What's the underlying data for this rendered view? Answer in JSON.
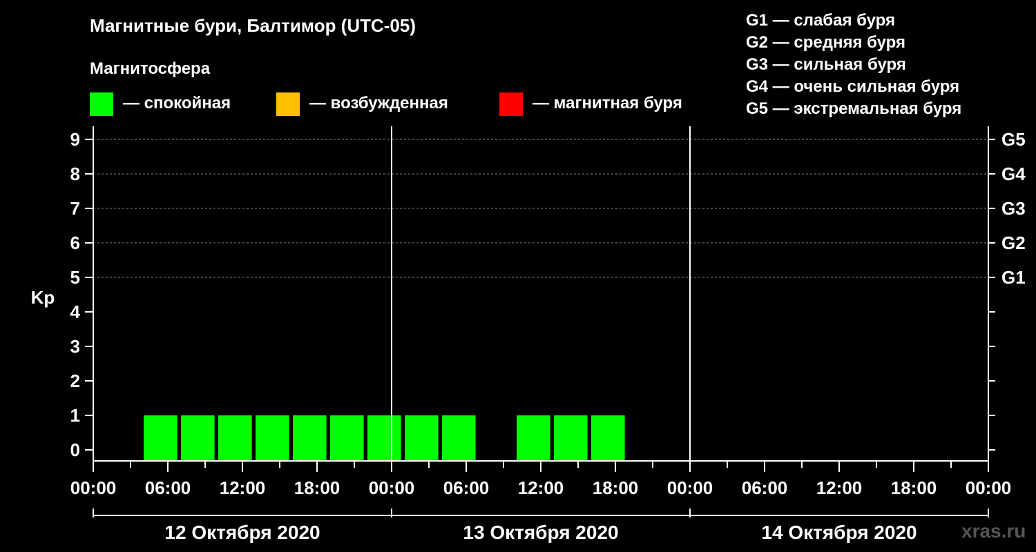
{
  "title": "Магнитные бури, Балтимор (UTC-05)",
  "subtitle": "Магнитосфера",
  "legend": [
    {
      "label": "— спокойная",
      "color": "#00ff00"
    },
    {
      "label": "— возбужденная",
      "color": "#ffbf00"
    },
    {
      "label": "— магнитная буря",
      "color": "#ff0000"
    }
  ],
  "gscale": [
    "G1 — слабая буря",
    "G2 — средняя буря",
    "G3 — сильная буря",
    "G4 — очень сильная буря",
    "G5 — экстремальная буря"
  ],
  "watermark": "xras.ru",
  "chart_data": {
    "type": "bar",
    "ylabel": "Kp",
    "ylim": [
      0,
      9
    ],
    "yticks": [
      0,
      1,
      2,
      3,
      4,
      5,
      6,
      7,
      8,
      9
    ],
    "right_labels": [
      {
        "y": 5,
        "label": "G1"
      },
      {
        "y": 6,
        "label": "G2"
      },
      {
        "y": 7,
        "label": "G3"
      },
      {
        "y": 8,
        "label": "G4"
      },
      {
        "y": 9,
        "label": "G5"
      }
    ],
    "grid_dashed_at": [
      5,
      6,
      7,
      8,
      9
    ],
    "x_range_hours": [
      0,
      72
    ],
    "xtick_labels": [
      "00:00",
      "06:00",
      "12:00",
      "18:00",
      "00:00",
      "06:00",
      "12:00",
      "18:00",
      "00:00",
      "06:00",
      "12:00",
      "18:00",
      "00:00"
    ],
    "days": [
      "12 Октября 2020",
      "13 Октября 2020",
      "14 Октября 2020"
    ],
    "bar_width_hours": 2.7,
    "color_quiet": "#00ff00",
    "bars": [
      {
        "start_hour": 4,
        "kp": 1
      },
      {
        "start_hour": 7,
        "kp": 1
      },
      {
        "start_hour": 10,
        "kp": 1
      },
      {
        "start_hour": 13,
        "kp": 1
      },
      {
        "start_hour": 16,
        "kp": 1
      },
      {
        "start_hour": 19,
        "kp": 1
      },
      {
        "start_hour": 22,
        "kp": 1
      },
      {
        "start_hour": 25,
        "kp": 1
      },
      {
        "start_hour": 28,
        "kp": 1
      },
      {
        "start_hour": 34,
        "kp": 1
      },
      {
        "start_hour": 37,
        "kp": 1
      },
      {
        "start_hour": 40,
        "kp": 1
      }
    ]
  }
}
